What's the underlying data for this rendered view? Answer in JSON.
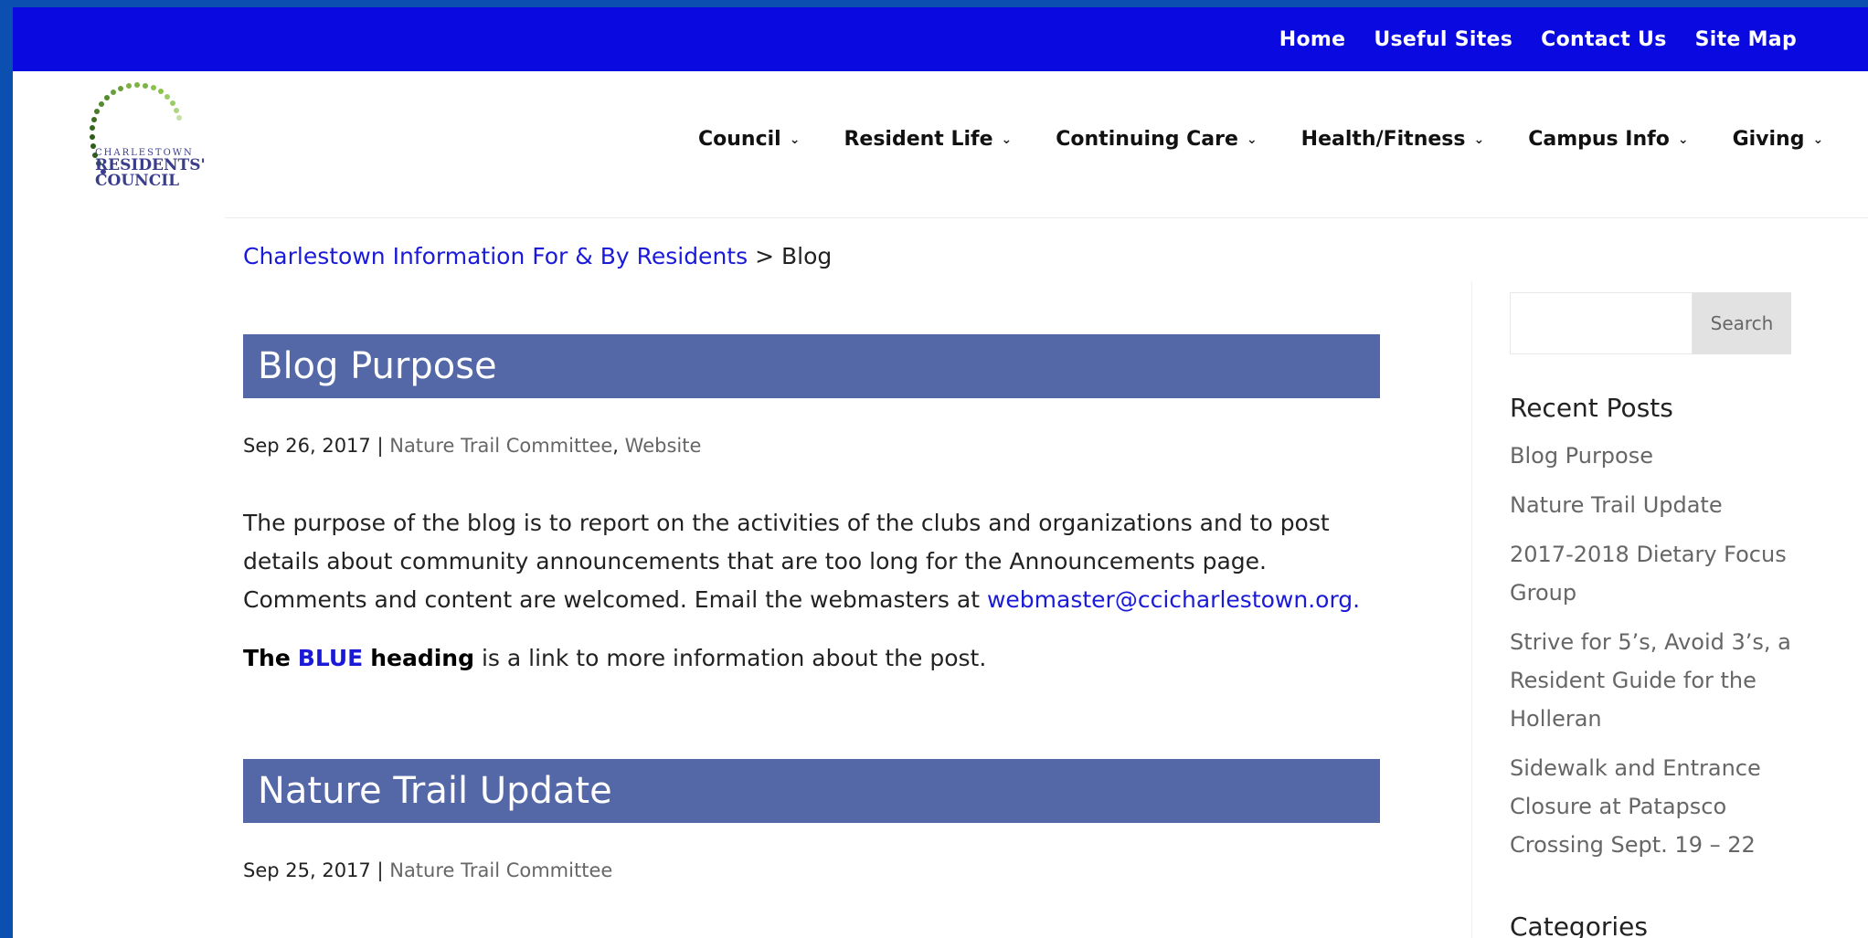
{
  "top_links": [
    "Home",
    "Useful Sites",
    "Contact Us",
    "Site Map"
  ],
  "logo": {
    "line1": "CHARLESTOWN",
    "line2": "RESIDENTS'",
    "line3": "COUNCIL"
  },
  "main_nav": [
    "Council",
    "Resident Life",
    "Continuing Care",
    "Health/Fitness",
    "Campus Info",
    "Giving"
  ],
  "breadcrumb": {
    "home": "Charlestown Information For & By Residents",
    "separator": ">",
    "current": "Blog"
  },
  "posts": [
    {
      "title": "Blog Purpose",
      "date": "Sep 26, 2017",
      "separator": "|",
      "categories": [
        "Nature Trail Committee",
        "Website"
      ],
      "body": "The purpose of the blog is to report on the activities of the clubs and organizations and to post details about community announcements that are too long for the Announcements page. Comments and content are welcomed. Email the webmasters at",
      "email": "webmaster@ccicharlestown.org."
    },
    {
      "title": "Nature Trail Update",
      "date": "Sep 25, 2017",
      "separator": "|",
      "categories": [
        "Nature Trail Committee"
      ]
    }
  ],
  "note": {
    "prefix": "The",
    "blue": "BLUE",
    "heading": "heading",
    "suffix": "is a link to more information about the post."
  },
  "sidebar": {
    "search_placeholder": "",
    "search_button": "Search",
    "recent_title": "Recent Posts",
    "recent_posts": [
      "Blog Purpose",
      "Nature Trail Update",
      "2017-2018 Dietary Focus Group",
      "Strive for 5’s, Avoid 3’s, a Resident Guide for the Holleran",
      "Sidewalk and Entrance Closure at Patapsco Crossing Sept. 19 – 22"
    ],
    "categories_title": "Categories"
  },
  "colors": {
    "frame": "#0b4fb0",
    "topbar": "#0a0ae0",
    "post_header": "#5468a8",
    "link": "#1a1ad8"
  }
}
